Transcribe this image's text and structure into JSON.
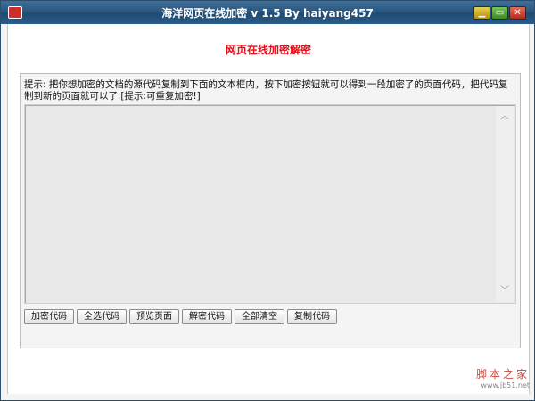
{
  "window": {
    "title": "海洋网页在线加密 v 1.5  By haiyang457",
    "controls": {
      "minimize_icon": "minimize-icon",
      "maximize_icon": "maximize-icon",
      "close_icon": "close-icon"
    }
  },
  "main": {
    "heading": "网页在线加密解密",
    "hint": "提示: 把你想加密的文档的源代码复制到下面的文本框内，按下加密按钮就可以得到一段加密了的页面代码，把代码复制到新的页面就可以了.[提示:可重复加密!]",
    "textarea_value": ""
  },
  "buttons": {
    "encrypt": "加密代码",
    "select_all": "全选代码",
    "preview": "预览页面",
    "decrypt": "解密代码",
    "clear_all": "全部清空",
    "copy": "复制代码"
  },
  "watermark": {
    "title": "脚本之家",
    "url": "www.jb51.net"
  },
  "colors": {
    "heading": "#e3101b",
    "titlebar": "#2b5780"
  }
}
